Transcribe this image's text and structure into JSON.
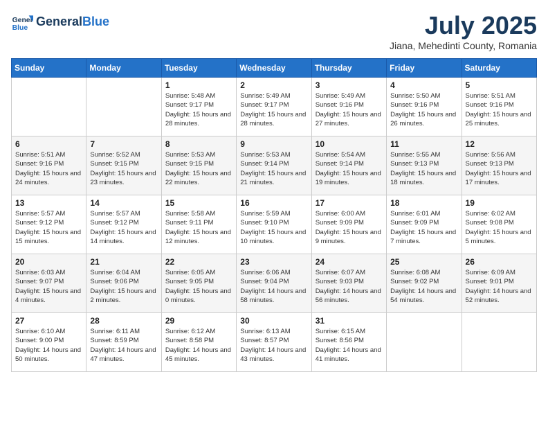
{
  "header": {
    "logo_general": "General",
    "logo_blue": "Blue",
    "month_title": "July 2025",
    "location": "Jiana, Mehedinti County, Romania"
  },
  "weekdays": [
    "Sunday",
    "Monday",
    "Tuesday",
    "Wednesday",
    "Thursday",
    "Friday",
    "Saturday"
  ],
  "weeks": [
    [
      {
        "day": "",
        "content": ""
      },
      {
        "day": "",
        "content": ""
      },
      {
        "day": "1",
        "content": "Sunrise: 5:48 AM\nSunset: 9:17 PM\nDaylight: 15 hours and 28 minutes."
      },
      {
        "day": "2",
        "content": "Sunrise: 5:49 AM\nSunset: 9:17 PM\nDaylight: 15 hours and 28 minutes."
      },
      {
        "day": "3",
        "content": "Sunrise: 5:49 AM\nSunset: 9:16 PM\nDaylight: 15 hours and 27 minutes."
      },
      {
        "day": "4",
        "content": "Sunrise: 5:50 AM\nSunset: 9:16 PM\nDaylight: 15 hours and 26 minutes."
      },
      {
        "day": "5",
        "content": "Sunrise: 5:51 AM\nSunset: 9:16 PM\nDaylight: 15 hours and 25 minutes."
      }
    ],
    [
      {
        "day": "6",
        "content": "Sunrise: 5:51 AM\nSunset: 9:16 PM\nDaylight: 15 hours and 24 minutes."
      },
      {
        "day": "7",
        "content": "Sunrise: 5:52 AM\nSunset: 9:15 PM\nDaylight: 15 hours and 23 minutes."
      },
      {
        "day": "8",
        "content": "Sunrise: 5:53 AM\nSunset: 9:15 PM\nDaylight: 15 hours and 22 minutes."
      },
      {
        "day": "9",
        "content": "Sunrise: 5:53 AM\nSunset: 9:14 PM\nDaylight: 15 hours and 21 minutes."
      },
      {
        "day": "10",
        "content": "Sunrise: 5:54 AM\nSunset: 9:14 PM\nDaylight: 15 hours and 19 minutes."
      },
      {
        "day": "11",
        "content": "Sunrise: 5:55 AM\nSunset: 9:13 PM\nDaylight: 15 hours and 18 minutes."
      },
      {
        "day": "12",
        "content": "Sunrise: 5:56 AM\nSunset: 9:13 PM\nDaylight: 15 hours and 17 minutes."
      }
    ],
    [
      {
        "day": "13",
        "content": "Sunrise: 5:57 AM\nSunset: 9:12 PM\nDaylight: 15 hours and 15 minutes."
      },
      {
        "day": "14",
        "content": "Sunrise: 5:57 AM\nSunset: 9:12 PM\nDaylight: 15 hours and 14 minutes."
      },
      {
        "day": "15",
        "content": "Sunrise: 5:58 AM\nSunset: 9:11 PM\nDaylight: 15 hours and 12 minutes."
      },
      {
        "day": "16",
        "content": "Sunrise: 5:59 AM\nSunset: 9:10 PM\nDaylight: 15 hours and 10 minutes."
      },
      {
        "day": "17",
        "content": "Sunrise: 6:00 AM\nSunset: 9:09 PM\nDaylight: 15 hours and 9 minutes."
      },
      {
        "day": "18",
        "content": "Sunrise: 6:01 AM\nSunset: 9:09 PM\nDaylight: 15 hours and 7 minutes."
      },
      {
        "day": "19",
        "content": "Sunrise: 6:02 AM\nSunset: 9:08 PM\nDaylight: 15 hours and 5 minutes."
      }
    ],
    [
      {
        "day": "20",
        "content": "Sunrise: 6:03 AM\nSunset: 9:07 PM\nDaylight: 15 hours and 4 minutes."
      },
      {
        "day": "21",
        "content": "Sunrise: 6:04 AM\nSunset: 9:06 PM\nDaylight: 15 hours and 2 minutes."
      },
      {
        "day": "22",
        "content": "Sunrise: 6:05 AM\nSunset: 9:05 PM\nDaylight: 15 hours and 0 minutes."
      },
      {
        "day": "23",
        "content": "Sunrise: 6:06 AM\nSunset: 9:04 PM\nDaylight: 14 hours and 58 minutes."
      },
      {
        "day": "24",
        "content": "Sunrise: 6:07 AM\nSunset: 9:03 PM\nDaylight: 14 hours and 56 minutes."
      },
      {
        "day": "25",
        "content": "Sunrise: 6:08 AM\nSunset: 9:02 PM\nDaylight: 14 hours and 54 minutes."
      },
      {
        "day": "26",
        "content": "Sunrise: 6:09 AM\nSunset: 9:01 PM\nDaylight: 14 hours and 52 minutes."
      }
    ],
    [
      {
        "day": "27",
        "content": "Sunrise: 6:10 AM\nSunset: 9:00 PM\nDaylight: 14 hours and 50 minutes."
      },
      {
        "day": "28",
        "content": "Sunrise: 6:11 AM\nSunset: 8:59 PM\nDaylight: 14 hours and 47 minutes."
      },
      {
        "day": "29",
        "content": "Sunrise: 6:12 AM\nSunset: 8:58 PM\nDaylight: 14 hours and 45 minutes."
      },
      {
        "day": "30",
        "content": "Sunrise: 6:13 AM\nSunset: 8:57 PM\nDaylight: 14 hours and 43 minutes."
      },
      {
        "day": "31",
        "content": "Sunrise: 6:15 AM\nSunset: 8:56 PM\nDaylight: 14 hours and 41 minutes."
      },
      {
        "day": "",
        "content": ""
      },
      {
        "day": "",
        "content": ""
      }
    ]
  ]
}
